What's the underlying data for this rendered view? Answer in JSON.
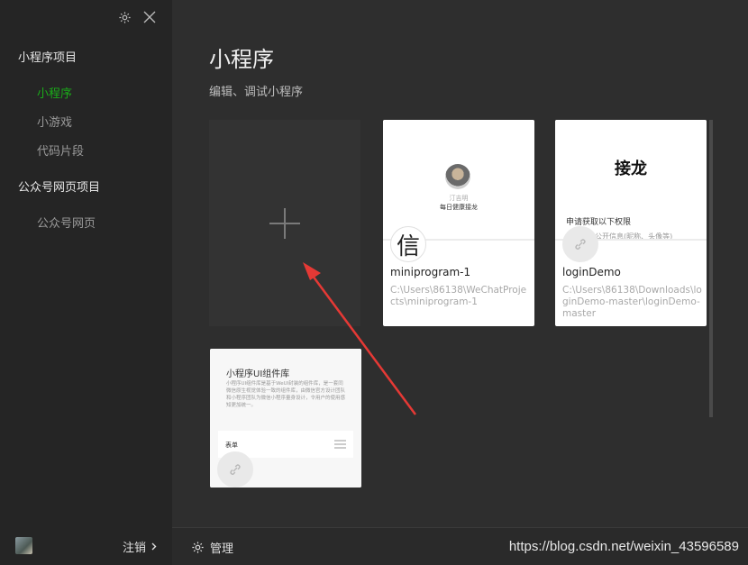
{
  "sidebar": {
    "sections": [
      {
        "title": "小程序项目",
        "items": [
          "小程序",
          "小游戏",
          "代码片段"
        ]
      },
      {
        "title": "公众号网页项目",
        "items": [
          "公众号网页"
        ]
      }
    ],
    "active_item": "小程序",
    "footer": {
      "logout_label": "注销"
    },
    "icons": {
      "settings": "gear-icon",
      "close": "close-icon"
    }
  },
  "main": {
    "title": "小程序",
    "subtitle": "编辑、调试小程序",
    "projects": [
      {
        "name": "miniprogram-1",
        "path": "C:\\Users\\86138\\WeChatProjects\\miniprogram-1",
        "badge": "信",
        "preview_name": "汀吉明",
        "preview_caption": "每日健康接龙"
      },
      {
        "name": "loginDemo",
        "path": "C:\\Users\\86138\\Downloads\\loginDemo-master\\loginDemo-master",
        "preview_logo": "接龙",
        "preview_line1": "申请获取以下权限",
        "preview_line2": "获得你的公开信息(昵称、头像等)"
      },
      {
        "name": "",
        "preview_title": "小程序UI组件库",
        "preview_desc": "小程序UI组件库是基于WeUI封装的组件库，是一套同微信原生视觉体验一致的组件库，由微信官方设计团队和小程序团队为微信小程序量身设计，令用户的使用感知更加统一。",
        "preview_row": "表单"
      }
    ]
  },
  "bottombar": {
    "manage_label": "管理",
    "watermark": "https://blog.csdn.net/weixin_43596589"
  },
  "colors": {
    "accent": "#1aad19",
    "arrow": "#e53935"
  }
}
